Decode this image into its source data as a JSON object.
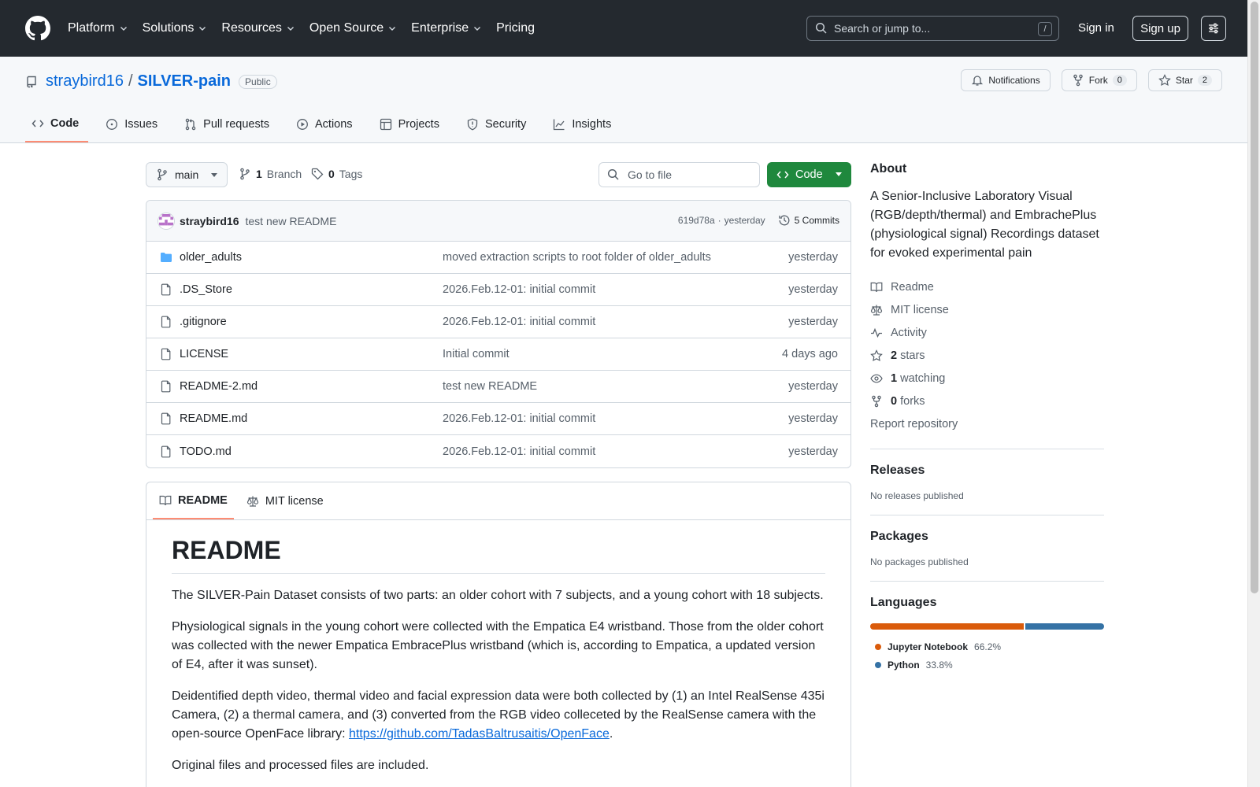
{
  "header": {
    "nav": [
      "Platform",
      "Solutions",
      "Resources",
      "Open Source",
      "Enterprise",
      "Pricing"
    ],
    "search_placeholder": "Search or jump to...",
    "search_shortcut": "/",
    "sign_in": "Sign in",
    "sign_up": "Sign up"
  },
  "repo": {
    "owner": "straybird16",
    "separator": "/",
    "name": "SILVER-pain",
    "visibility": "Public",
    "notifications_label": "Notifications",
    "fork_label": "Fork",
    "fork_count": "0",
    "star_label": "Star",
    "star_count": "2",
    "tabs": [
      "Code",
      "Issues",
      "Pull requests",
      "Actions",
      "Projects",
      "Security",
      "Insights"
    ]
  },
  "toolbar": {
    "branch": "main",
    "branch_count": "1",
    "branch_label": "Branch",
    "tag_count": "0",
    "tag_label": "Tags",
    "goto_placeholder": "Go to file",
    "code_label": "Code"
  },
  "latest_commit": {
    "author": "straybird16",
    "message": "test new README",
    "hash": "619d78a",
    "dot": "·",
    "time": "yesterday",
    "commits_label": "5 Commits"
  },
  "files": [
    {
      "name": "older_adults",
      "type": "folder",
      "message": "moved extraction scripts to root folder of older_adults",
      "date": "yesterday"
    },
    {
      "name": ".DS_Store",
      "type": "file",
      "message": "2026.Feb.12-01: initial commit",
      "date": "yesterday"
    },
    {
      "name": ".gitignore",
      "type": "file",
      "message": "2026.Feb.12-01: initial commit",
      "date": "yesterday"
    },
    {
      "name": "LICENSE",
      "type": "file",
      "message": "Initial commit",
      "date": "4 days ago"
    },
    {
      "name": "README-2.md",
      "type": "file",
      "message": "test new README",
      "date": "yesterday"
    },
    {
      "name": "README.md",
      "type": "file",
      "message": "2026.Feb.12-01: initial commit",
      "date": "yesterday"
    },
    {
      "name": "TODO.md",
      "type": "file",
      "message": "2026.Feb.12-01: initial commit",
      "date": "yesterday"
    }
  ],
  "readme": {
    "tab_readme": "README",
    "tab_license": "MIT license",
    "title": "README",
    "p1": "The SILVER-Pain Dataset consists of two parts: an older cohort with 7 subjects, and a young cohort with 18 subjects.",
    "p2": "Physiological signals in the young cohort were collected with the Empatica E4 wristband. Those from the older cohort was collected with the newer Empatica EmbracePlus wristband (which is, according to Empatica, a updated version of E4, after it was sunset).",
    "p3_before": "Deidentified depth video, thermal video and facial expression data were both collected by (1) an Intel RealSense 435i Camera, (2) a thermal camera, and (3) converted from the RGB video colleceted by the RealSense camera with the open-source OpenFace library: ",
    "p3_link": "https://github.com/TadasBaltrusaitis/OpenFace",
    "p3_after": ".",
    "p4": "Original files and processed files are included."
  },
  "about": {
    "title": "About",
    "description": "A Senior-Inclusive Laboratory Visual (RGB/depth/thermal) and EmbrachePlus (physiological signal) Recordings dataset for evoked experimental pain",
    "readme": "Readme",
    "license": "MIT license",
    "activity": "Activity",
    "stars_count": "2",
    "stars_label": "stars",
    "watching_count": "1",
    "watching_label": "watching",
    "forks_count": "0",
    "forks_label": "forks",
    "report": "Report repository"
  },
  "releases": {
    "title": "Releases",
    "text": "No releases published"
  },
  "packages": {
    "title": "Packages",
    "text": "No packages published"
  },
  "languages": {
    "title": "Languages",
    "items": [
      {
        "name": "Jupyter Notebook",
        "percent": "66.2%",
        "value": 66.2,
        "color": "#DA5B0B"
      },
      {
        "name": "Python",
        "percent": "33.8%",
        "value": 33.8,
        "color": "#3572A5"
      }
    ]
  },
  "colors": {
    "accent": "#0969da",
    "primary_button": "#1f883d",
    "header_bg": "#24292f",
    "tab_underline": "#fd8c73"
  }
}
